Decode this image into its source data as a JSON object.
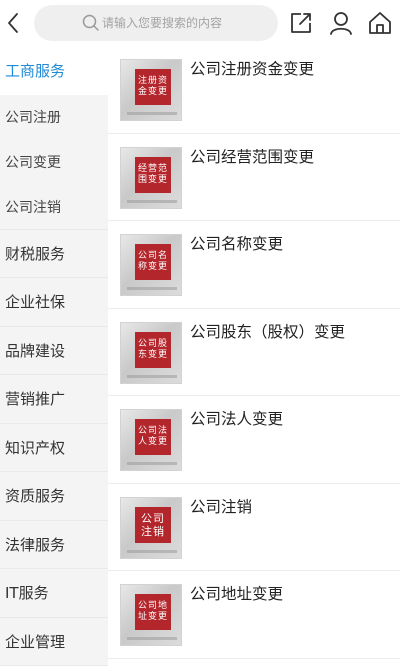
{
  "search": {
    "placeholder": "请输入您要搜索的内容"
  },
  "sidebar": {
    "items": [
      {
        "label": "工商服务",
        "active": true
      },
      {
        "label": "公司注册",
        "sub": true
      },
      {
        "label": "公司变更",
        "sub": true
      },
      {
        "label": "公司注销",
        "sub": true
      },
      {
        "label": "财税服务"
      },
      {
        "label": "企业社保"
      },
      {
        "label": "品牌建设"
      },
      {
        "label": "营销推广"
      },
      {
        "label": "知识产权"
      },
      {
        "label": "资质服务"
      },
      {
        "label": "法律服务"
      },
      {
        "label": "IT服务"
      },
      {
        "label": "企业管理"
      }
    ]
  },
  "services": [
    {
      "title": "公司注册资金变更",
      "seal": "注册资\n金变更"
    },
    {
      "title": "公司经营范围变更",
      "seal": "经营范\n围变更"
    },
    {
      "title": "公司名称变更",
      "seal": "公司名\n称变更"
    },
    {
      "title": "公司股东（股权）变更",
      "seal": "公司股\n东变更"
    },
    {
      "title": "公司法人变更",
      "seal": "公司法\n人变更"
    },
    {
      "title": "公司注销",
      "seal": "公司\n注销"
    },
    {
      "title": "公司地址变更",
      "seal": "公司地\n址变更"
    }
  ],
  "colors": {
    "accent": "#1f8ad6",
    "seal": "#b3262c",
    "sidebar_bg": "#f4f4f4"
  },
  "icons": [
    "back-icon",
    "search-icon",
    "share-icon",
    "user-icon",
    "home-icon"
  ]
}
